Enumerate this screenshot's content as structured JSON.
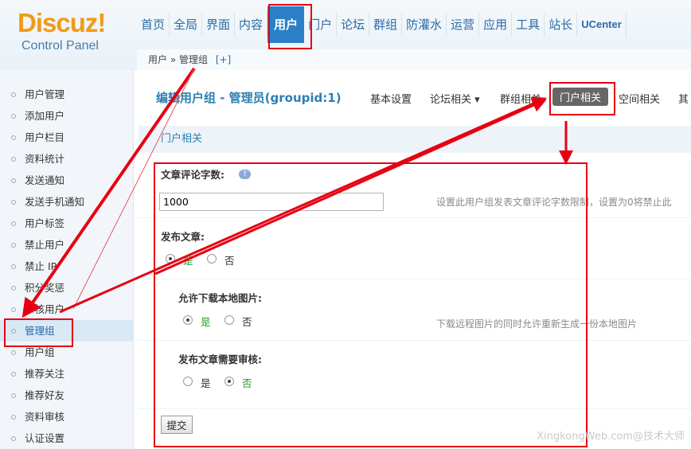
{
  "logo": {
    "brand": "Discuz!",
    "subtitle": "Control Panel"
  },
  "topnav": [
    "首页",
    "全局",
    "界面",
    "内容",
    "用户",
    "门户",
    "论坛",
    "群组",
    "防灌水",
    "运营",
    "应用",
    "工具",
    "站长",
    "UCenter"
  ],
  "breadcrumb": {
    "text": "用户 » 管理组",
    "add": "[+]"
  },
  "sidebar": [
    "用户管理",
    "添加用户",
    "用户栏目",
    "资料统计",
    "发送通知",
    "发送手机通知",
    "用户标签",
    "禁止用户",
    "禁止 IP",
    "积分奖惩",
    "审核用户",
    "管理组",
    "用户组",
    "推荐关注",
    "推荐好友",
    "资料审核",
    "认证设置"
  ],
  "page": {
    "title": "编辑用户组 - 管理员(groupid:1)",
    "subtabs": [
      "基本设置",
      "论坛相关 ▾",
      "群组相关",
      "门户相关",
      "空间相关",
      "其"
    ],
    "section": "门户相关"
  },
  "form": {
    "comment_label": "文章评论字数:",
    "help_icon": "?",
    "comment_value": "1000",
    "comment_tip": "设置此用户组发表文章评论字数限制，设置为0将禁止此",
    "publish_label": "发布文章:",
    "local_img_label": "允许下载本地图片:",
    "local_img_tip": "下载远程图片的同时允许重新生成一份本地图片",
    "audit_label": "发布文章需要审核:",
    "yes": "是",
    "no": "否",
    "submit": "提交"
  },
  "watermark": "XingkongWeb.com@技术大师"
}
